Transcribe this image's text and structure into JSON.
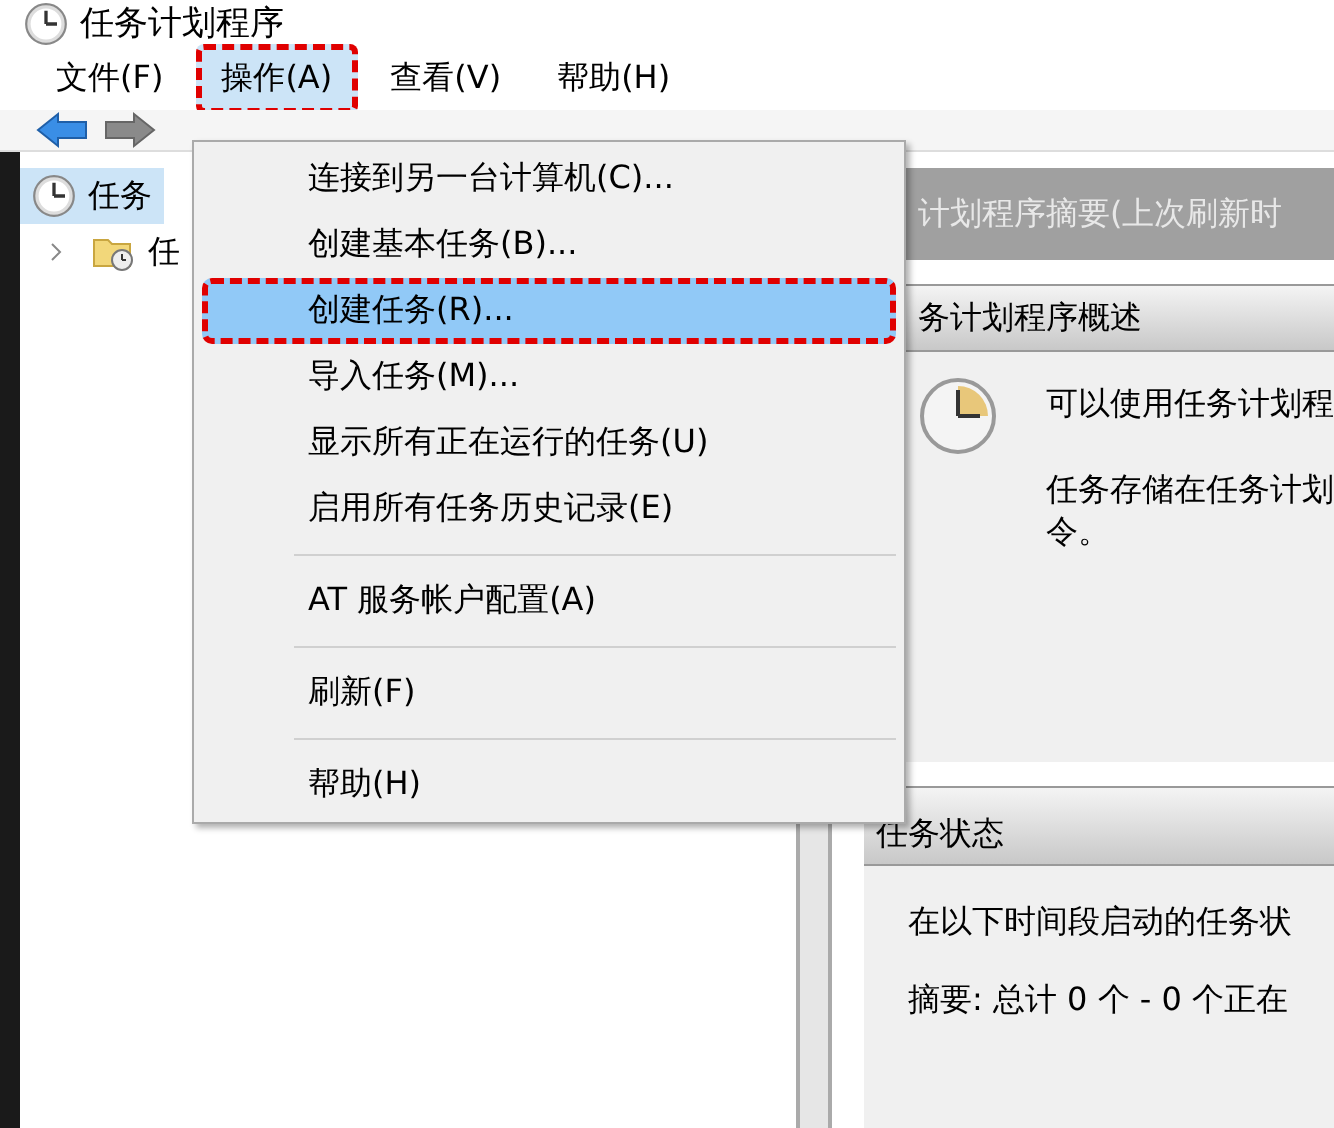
{
  "window": {
    "title": "任务计划程序"
  },
  "menu_bar": [
    {
      "label": "文件(F)",
      "selected": false,
      "annotated": false
    },
    {
      "label": "操作(A)",
      "selected": true,
      "annotated": true
    },
    {
      "label": "查看(V)",
      "selected": false,
      "annotated": false
    },
    {
      "label": "帮助(H)",
      "selected": false,
      "annotated": false
    }
  ],
  "tree": [
    {
      "label": "任务",
      "selected": true,
      "children": [
        {
          "label": "任",
          "selected": false,
          "expanded": false
        }
      ]
    }
  ],
  "dropdown_menu": [
    {
      "kind": "command",
      "label": "连接到另一台计算机(C)...",
      "selected": false,
      "annotated": false
    },
    {
      "kind": "command",
      "label": "创建基本任务(B)...",
      "selected": false,
      "annotated": false
    },
    {
      "kind": "command",
      "label": "创建任务(R)...",
      "selected": true,
      "annotated": true
    },
    {
      "kind": "command",
      "label": "导入任务(M)...",
      "selected": false,
      "annotated": false
    },
    {
      "kind": "command",
      "label": "显示所有正在运行的任务(U)",
      "selected": false,
      "annotated": false
    },
    {
      "kind": "command",
      "label": "启用所有任务历史记录(E)",
      "selected": false,
      "annotated": false
    },
    {
      "kind": "separator"
    },
    {
      "kind": "command",
      "label": "AT 服务帐户配置(A)",
      "selected": false,
      "annotated": false
    },
    {
      "kind": "separator"
    },
    {
      "kind": "command",
      "label": "刷新(F)",
      "selected": false,
      "annotated": false
    },
    {
      "kind": "separator"
    },
    {
      "kind": "command",
      "label": "帮助(H)",
      "selected": false,
      "annotated": false
    }
  ],
  "summary_header": "计划程序摘要(上次刷新时",
  "overview": {
    "title": "务计划程序概述",
    "paragraphs": [
      "可以使用任务计划程",
      "任务存储在任务计划",
      "令。"
    ]
  },
  "task_status": {
    "title": "任务状态",
    "lines": [
      "在以下时间段启动的任务状",
      "摘要: 总计 0 个 - 0 个正在"
    ]
  }
}
